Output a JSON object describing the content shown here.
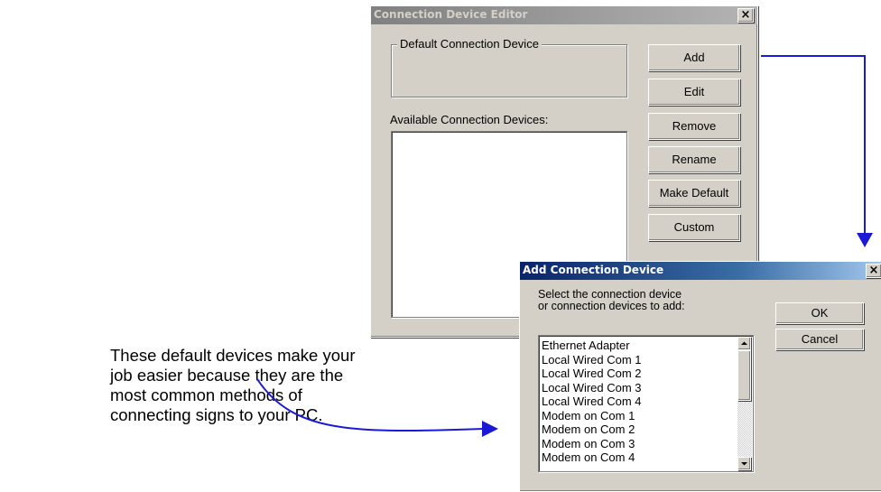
{
  "editor": {
    "title": "Connection Device Editor",
    "close_label": "×",
    "group_label": "Default Connection Device",
    "available_label": "Available Connection Devices:",
    "buttons": [
      "Add",
      "Edit",
      "Remove",
      "Rename",
      "Make Default",
      "Custom"
    ]
  },
  "add_dialog": {
    "title": "Add Connection Device",
    "close_label": "×",
    "prompt_line1": "Select the connection device",
    "prompt_line2": "or connection devices to add:",
    "ok_label": "OK",
    "cancel_label": "Cancel",
    "items": [
      "Ethernet Adapter",
      "Local Wired Com 1",
      "Local Wired Com 2",
      "Local Wired Com 3",
      "Local Wired Com 4",
      "Modem on Com 1",
      "Modem on Com 2",
      "Modem on Com 3",
      "Modem on Com 4"
    ]
  },
  "annotation": {
    "text": "These default devices make your job easier because they are the most common methods of connecting signs to your PC."
  },
  "colors": {
    "arrow": "#1a1ad6",
    "dialog_face": "#d4d0c8",
    "add_title_bg": "#0a246a",
    "editor_title_bg": "#808080"
  }
}
